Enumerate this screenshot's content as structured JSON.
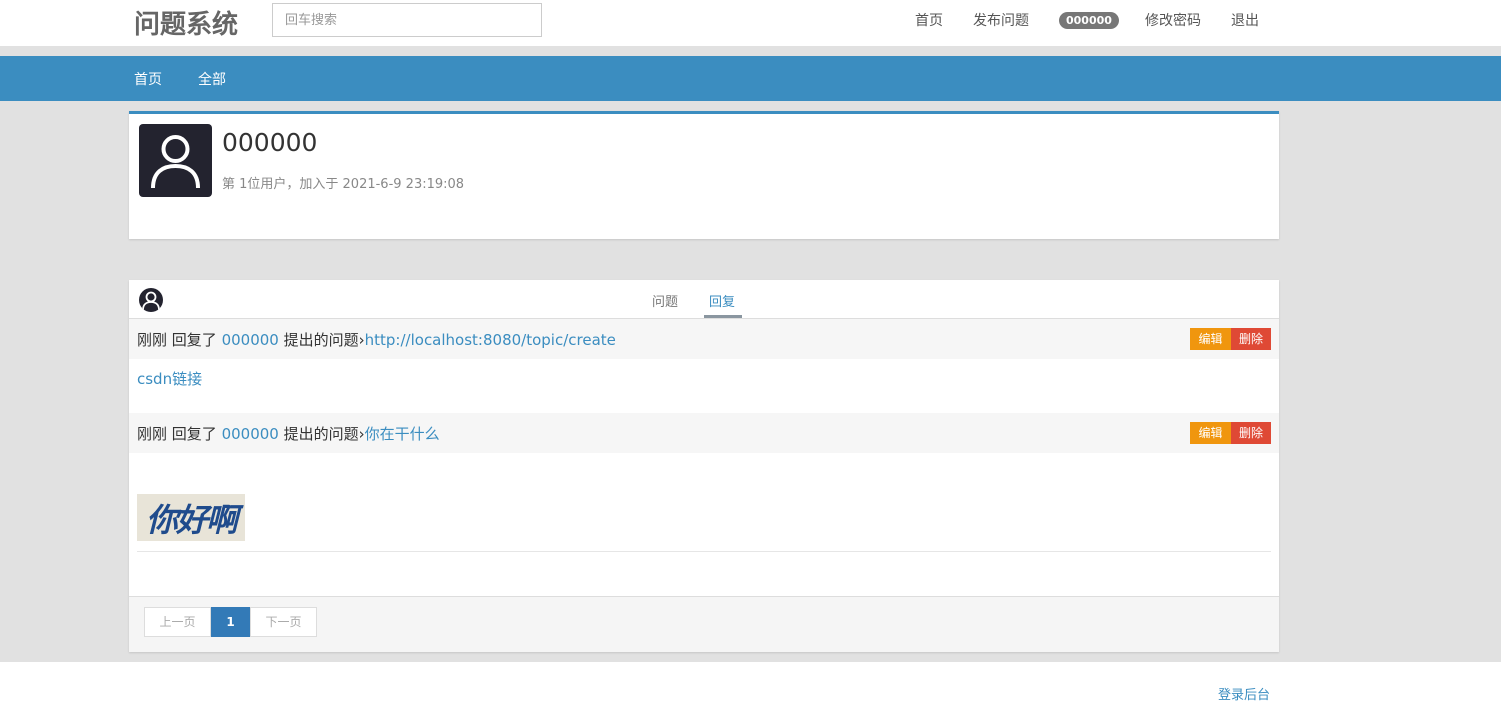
{
  "header": {
    "logo": "问题系统",
    "search_placeholder": "回车搜索",
    "nav": {
      "home": "首页",
      "post_question": "发布问题",
      "user_badge": "000000",
      "change_password": "修改密码",
      "logout": "退出"
    }
  },
  "subnav": {
    "home": "首页",
    "all": "全部"
  },
  "profile": {
    "name": "000000",
    "meta": "第 1位用户，加入于 2021-6-9 23:19:08"
  },
  "tabs": {
    "questions": "问题",
    "replies": "回复"
  },
  "replies": [
    {
      "time": "刚刚",
      "verb": "回复了",
      "author": "000000",
      "suffix": "提出的问题›",
      "question": "http://localhost:8080/topic/create",
      "body": "csdn链接",
      "edit": "编辑",
      "delete": "删除"
    },
    {
      "time": "刚刚",
      "verb": "回复了",
      "author": "000000",
      "suffix": "提出的问题›",
      "question": "你在干什么",
      "body_image_text": "你好啊",
      "edit": "编辑",
      "delete": "删除"
    }
  ],
  "pagination": {
    "prev": "上一页",
    "current": "1",
    "next": "下一页"
  },
  "footer": {
    "admin_login": "登录后台"
  },
  "colors": {
    "accent": "#3b8dc0",
    "edit": "#f0960e",
    "delete": "#df4935",
    "avatar_bg": "#23232f"
  }
}
